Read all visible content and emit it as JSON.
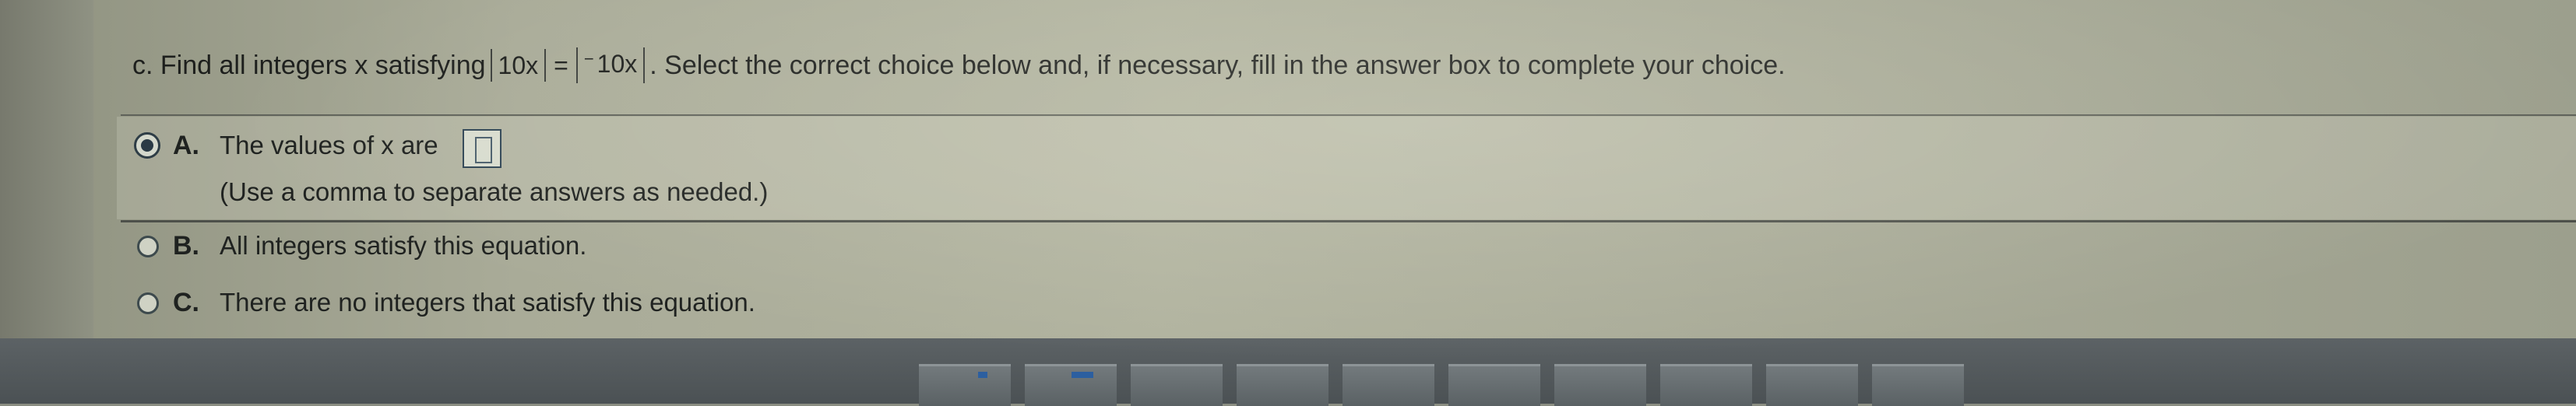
{
  "question": {
    "prefix": "c. Find all integers x satisfying",
    "lhs": "10x",
    "equals": "=",
    "rhs_sign": "−",
    "rhs": "10x",
    "suffix": ". Select the correct choice below and, if necessary, fill in the answer box to complete your choice."
  },
  "choices": [
    {
      "letter": "A.",
      "text": "The values of x are",
      "hint": "(Use a comma to separate answers as needed.)",
      "selected": true,
      "answer_value": ""
    },
    {
      "letter": "B.",
      "text": "All integers satisfy this equation.",
      "selected": false
    },
    {
      "letter": "C.",
      "text": "There are no integers that satisfy this equation.",
      "selected": false
    }
  ],
  "colors": {
    "selection_accent": "#2a3a45",
    "answer_box_border": "#2f4555"
  },
  "icons": {
    "radio_selected": "radio-selected-icon",
    "radio_unselected": "radio-unselected-icon"
  }
}
